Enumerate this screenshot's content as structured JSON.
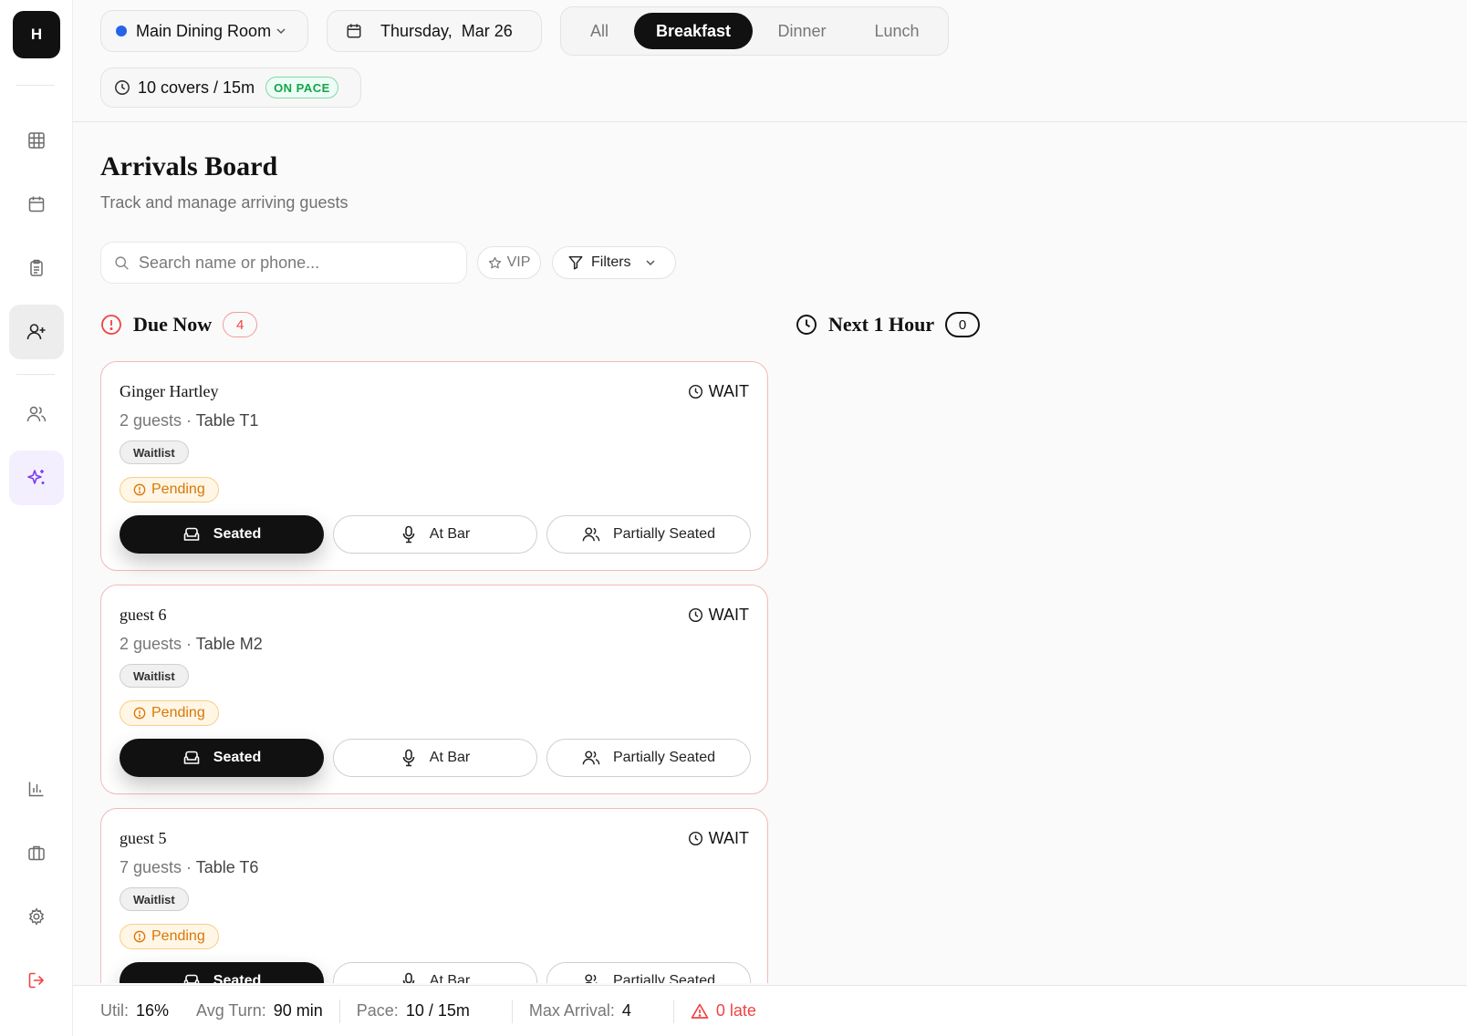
{
  "app": {
    "logo_letter": "H"
  },
  "header": {
    "room": "Main Dining Room",
    "date_day": "Thursday,",
    "date_rest": "Mar 26",
    "meal_tabs": [
      "All",
      "Breakfast",
      "Dinner",
      "Lunch"
    ],
    "active_tab": "Breakfast",
    "pace_text": "10 covers / 15m",
    "pace_badge": "ON PACE"
  },
  "page": {
    "title": "Arrivals Board",
    "subtitle": "Track and manage arriving guests",
    "search_placeholder": "Search name or phone...",
    "vip_label": "VIP",
    "filters_label": "Filters"
  },
  "sections": {
    "due_now": {
      "label": "Due Now",
      "count": "4"
    },
    "next_hour": {
      "label": "Next 1 Hour",
      "count": "0"
    }
  },
  "cards": [
    {
      "name": "Ginger Hartley",
      "guests": "2 guests",
      "table": "Table T1",
      "tag": "Waitlist",
      "status": "Pending",
      "wait_label": "WAIT"
    },
    {
      "name": "guest 6",
      "guests": "2 guests",
      "table": "Table M2",
      "tag": "Waitlist",
      "status": "Pending",
      "wait_label": "WAIT"
    },
    {
      "name": "guest 5",
      "guests": "7 guests",
      "table": "Table T6",
      "tag": "Waitlist",
      "status": "Pending",
      "wait_label": "WAIT"
    }
  ],
  "actions": {
    "seated": "Seated",
    "at_bar": "At Bar",
    "partially_seated": "Partially Seated"
  },
  "statusbar": {
    "util_label": "Util:",
    "util_value": "16%",
    "avg_label": "Avg Turn:",
    "avg_value": "90 min",
    "pace_label": "Pace:",
    "pace_value": "10 / 15m",
    "max_label": "Max Arrival:",
    "max_value": "4",
    "late": "0 late"
  }
}
